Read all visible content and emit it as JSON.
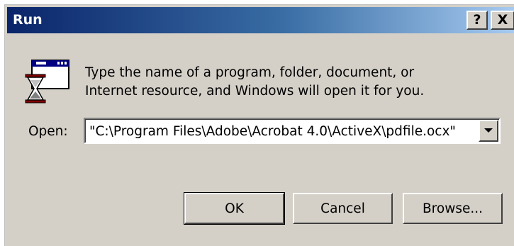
{
  "window": {
    "title": "Run"
  },
  "titlebar": {
    "help_label": "?",
    "close_label": "X"
  },
  "icon": {
    "name": "run-program-icon"
  },
  "description": {
    "line1": "Type the name of a program, folder, document, or",
    "line2": "Internet resource, and Windows will open it for you."
  },
  "open": {
    "label": "Open:",
    "value": "\"C:\\Program Files\\Adobe\\Acrobat 4.0\\ActiveX\\pdfile.ocx\""
  },
  "buttons": {
    "ok": "OK",
    "cancel": "Cancel",
    "browse": "Browse..."
  },
  "colors": {
    "face": "#d4d0c8",
    "title_start": "#0a246a",
    "title_end": "#a6caf0"
  }
}
